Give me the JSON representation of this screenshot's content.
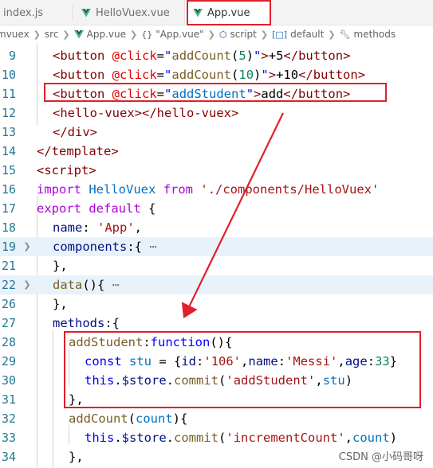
{
  "tabs": [
    {
      "label": "index.js",
      "active": false,
      "icon": "none"
    },
    {
      "label": "HelloVuex.vue",
      "active": false,
      "icon": "vue-icon"
    },
    {
      "label": "App.vue",
      "active": true,
      "icon": "vue-icon"
    }
  ],
  "breadcrumb": {
    "items": [
      "mvuex",
      "src",
      "App.vue",
      "\"App.vue\"",
      "script",
      "default",
      "methods"
    ],
    "item_icons": [
      "none",
      "none",
      "vue-icon",
      "braces-icon",
      "cube-icon",
      "cube-icon",
      "wrench-icon"
    ]
  },
  "editor": {
    "lines": [
      {
        "number": "9",
        "tokens": [
          {
            "t": "<",
            "c": "tag"
          },
          {
            "t": "button",
            "c": "tag"
          },
          {
            "t": " @click",
            "c": "attr"
          },
          {
            "t": "=",
            "c": "txt"
          },
          {
            "t": "\"",
            "c": "str"
          },
          {
            "t": "addCount",
            "c": "fn"
          },
          {
            "t": "(",
            "c": "pun"
          },
          {
            "t": "5",
            "c": "num"
          },
          {
            "t": ")",
            "c": "pun"
          },
          {
            "t": "\"",
            "c": "str"
          },
          {
            "t": ">",
            "c": "tag"
          },
          {
            "t": "+5",
            "c": "txt"
          },
          {
            "t": "</",
            "c": "tag"
          },
          {
            "t": "button",
            "c": "tag"
          },
          {
            "t": ">",
            "c": "tag"
          }
        ]
      },
      {
        "number": "10",
        "tokens": [
          {
            "t": "<",
            "c": "tag"
          },
          {
            "t": "button",
            "c": "tag"
          },
          {
            "t": " @click",
            "c": "attr"
          },
          {
            "t": "=",
            "c": "txt"
          },
          {
            "t": "\"",
            "c": "str"
          },
          {
            "t": "addCount",
            "c": "fn"
          },
          {
            "t": "(",
            "c": "pun"
          },
          {
            "t": "10",
            "c": "num"
          },
          {
            "t": ")",
            "c": "pun"
          },
          {
            "t": "\"",
            "c": "str"
          },
          {
            "t": ">",
            "c": "tag"
          },
          {
            "t": "+10",
            "c": "txt"
          },
          {
            "t": "</",
            "c": "tag"
          },
          {
            "t": "button",
            "c": "tag"
          },
          {
            "t": ">",
            "c": "tag"
          }
        ]
      },
      {
        "number": "11",
        "tokens": [
          {
            "t": "<",
            "c": "tag"
          },
          {
            "t": "button",
            "c": "tag"
          },
          {
            "t": " @click",
            "c": "attr"
          },
          {
            "t": "=",
            "c": "txt"
          },
          {
            "t": "\"",
            "c": "str"
          },
          {
            "t": "addStudent",
            "c": "var"
          },
          {
            "t": "\"",
            "c": "str"
          },
          {
            "t": ">",
            "c": "tag"
          },
          {
            "t": "add",
            "c": "txt"
          },
          {
            "t": "</",
            "c": "tag"
          },
          {
            "t": "button",
            "c": "tag"
          },
          {
            "t": ">",
            "c": "tag"
          }
        ]
      },
      {
        "number": "12",
        "tokens": [
          {
            "t": "<",
            "c": "tag"
          },
          {
            "t": "hello-vuex",
            "c": "tag"
          },
          {
            "t": "></",
            "c": "tag"
          },
          {
            "t": "hello-vuex",
            "c": "tag"
          },
          {
            "t": ">",
            "c": "tag"
          }
        ]
      },
      {
        "number": "13",
        "tokens": [
          {
            "t": "</",
            "c": "tag"
          },
          {
            "t": "div",
            "c": "tag"
          },
          {
            "t": ">",
            "c": "tag"
          }
        ]
      },
      {
        "number": "14",
        "tokens": [
          {
            "t": "</",
            "c": "tag"
          },
          {
            "t": "template",
            "c": "tag"
          },
          {
            "t": ">",
            "c": "tag"
          }
        ]
      },
      {
        "number": "15",
        "tokens": [
          {
            "t": "<",
            "c": "tag"
          },
          {
            "t": "script",
            "c": "tag"
          },
          {
            "t": ">",
            "c": "tag"
          }
        ]
      },
      {
        "number": "16",
        "tokens": [
          {
            "t": "import",
            "c": "ctl"
          },
          {
            "t": " ",
            "c": "txt"
          },
          {
            "t": "HelloVuex",
            "c": "var"
          },
          {
            "t": " ",
            "c": "txt"
          },
          {
            "t": "from",
            "c": "ctl"
          },
          {
            "t": " ",
            "c": "txt"
          },
          {
            "t": "'./components/HelloVuex'",
            "c": "val"
          }
        ]
      },
      {
        "number": "17",
        "tokens": [
          {
            "t": "export",
            "c": "ctl"
          },
          {
            "t": " ",
            "c": "txt"
          },
          {
            "t": "default",
            "c": "ctl"
          },
          {
            "t": " {",
            "c": "pun"
          }
        ]
      },
      {
        "number": "18",
        "tokens": [
          {
            "t": "name",
            "c": "prop"
          },
          {
            "t": ": ",
            "c": "pun"
          },
          {
            "t": "'App'",
            "c": "val"
          },
          {
            "t": ",",
            "c": "pun"
          }
        ]
      },
      {
        "number": "19",
        "tokens": [
          {
            "t": "components",
            "c": "prop"
          },
          {
            "t": ":{",
            "c": "pun"
          },
          {
            "t": " ⋯",
            "c": "ell"
          }
        ]
      },
      {
        "number": "21",
        "tokens": [
          {
            "t": "},",
            "c": "pun"
          }
        ]
      },
      {
        "number": "22",
        "tokens": [
          {
            "t": "data",
            "c": "fn"
          },
          {
            "t": "(){",
            "c": "pun"
          },
          {
            "t": " ⋯",
            "c": "ell"
          }
        ]
      },
      {
        "number": "26",
        "tokens": [
          {
            "t": "},",
            "c": "pun"
          }
        ]
      },
      {
        "number": "27",
        "tokens": [
          {
            "t": "methods",
            "c": "prop"
          },
          {
            "t": ":{",
            "c": "pun"
          }
        ]
      },
      {
        "number": "28",
        "tokens": [
          {
            "t": "addStudent",
            "c": "fn"
          },
          {
            "t": ":",
            "c": "pun"
          },
          {
            "t": "function",
            "c": "kw"
          },
          {
            "t": "(){",
            "c": "pun"
          }
        ]
      },
      {
        "number": "29",
        "tokens": [
          {
            "t": "const",
            "c": "kw"
          },
          {
            "t": " ",
            "c": "txt"
          },
          {
            "t": "stu",
            "c": "var"
          },
          {
            "t": " = {",
            "c": "pun"
          },
          {
            "t": "id",
            "c": "prop"
          },
          {
            "t": ":",
            "c": "pun"
          },
          {
            "t": "'106'",
            "c": "val"
          },
          {
            "t": ",",
            "c": "pun"
          },
          {
            "t": "name",
            "c": "prop"
          },
          {
            "t": ":",
            "c": "pun"
          },
          {
            "t": "'Messi'",
            "c": "val"
          },
          {
            "t": ",",
            "c": "pun"
          },
          {
            "t": "age",
            "c": "prop"
          },
          {
            "t": ":",
            "c": "pun"
          },
          {
            "t": "33",
            "c": "num"
          },
          {
            "t": "}",
            "c": "pun"
          }
        ]
      },
      {
        "number": "30",
        "tokens": [
          {
            "t": "this",
            "c": "kw"
          },
          {
            "t": ".",
            "c": "pun"
          },
          {
            "t": "$store",
            "c": "prop"
          },
          {
            "t": ".",
            "c": "pun"
          },
          {
            "t": "commit",
            "c": "fn"
          },
          {
            "t": "(",
            "c": "pun"
          },
          {
            "t": "'addStudent'",
            "c": "val"
          },
          {
            "t": ",",
            "c": "pun"
          },
          {
            "t": "stu",
            "c": "var"
          },
          {
            "t": ")",
            "c": "pun"
          }
        ]
      },
      {
        "number": "31",
        "tokens": [
          {
            "t": "},",
            "c": "pun"
          }
        ]
      },
      {
        "number": "32",
        "tokens": [
          {
            "t": "addCount",
            "c": "fn"
          },
          {
            "t": "(",
            "c": "pun"
          },
          {
            "t": "count",
            "c": "var"
          },
          {
            "t": "){",
            "c": "pun"
          }
        ]
      },
      {
        "number": "33",
        "tokens": [
          {
            "t": "this",
            "c": "kw"
          },
          {
            "t": ".",
            "c": "pun"
          },
          {
            "t": "$store",
            "c": "prop"
          },
          {
            "t": ".",
            "c": "pun"
          },
          {
            "t": "commit",
            "c": "fn"
          },
          {
            "t": "(",
            "c": "pun"
          },
          {
            "t": "'incrementCount'",
            "c": "val"
          },
          {
            "t": ",",
            "c": "pun"
          },
          {
            "t": "count",
            "c": "var"
          },
          {
            "t": ")",
            "c": "pun"
          }
        ]
      },
      {
        "number": "34",
        "tokens": [
          {
            "t": "},",
            "c": "pun"
          }
        ]
      }
    ]
  },
  "watermark": "CSDN @小码哥呀",
  "colors": {
    "annotation_red": "#e0202b",
    "line_number": "#237893",
    "tag": "#800000",
    "attribute": "#e50000",
    "keyword": "#0000ff",
    "control_keyword": "#af00db",
    "string": "#a31515",
    "property": "#001080",
    "function": "#795e26",
    "variable": "#0070c1",
    "number": "#098658",
    "highlight_line": "#e8f2fb"
  }
}
